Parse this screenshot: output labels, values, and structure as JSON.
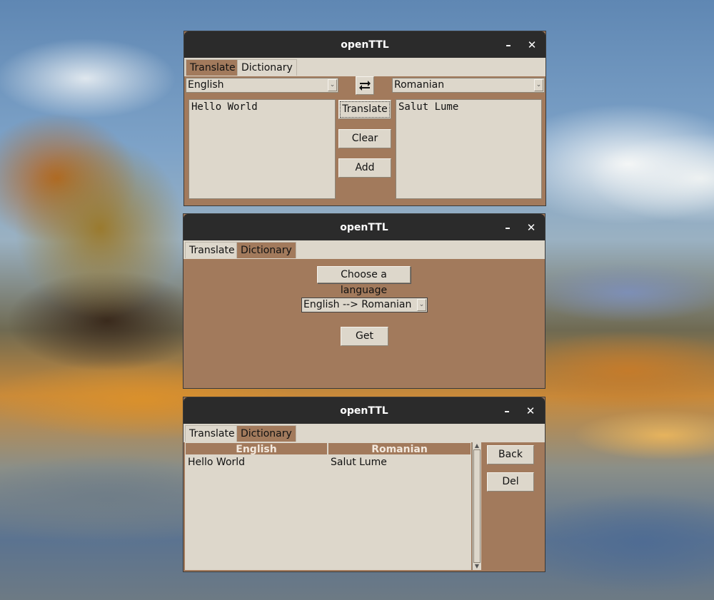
{
  "window1": {
    "title": "openTTL",
    "tabs": [
      "Translate",
      "Dictionary"
    ],
    "source_language": "English",
    "target_language": "Romanian",
    "source_text": "Hello World",
    "target_text": "Salut Lume",
    "buttons": {
      "translate": "Translate",
      "clear": "Clear",
      "add": "Add"
    }
  },
  "window2": {
    "title": "openTTL",
    "tabs": [
      "Translate",
      "Dictionary"
    ],
    "choose_button": "Choose a language",
    "language_pair": "English --> Romanian",
    "get_button": "Get"
  },
  "window3": {
    "title": "openTTL",
    "tabs": [
      "Translate",
      "Dictionary"
    ],
    "columns": [
      "English",
      "Romanian"
    ],
    "rows": [
      [
        "Hello World",
        "Salut Lume"
      ]
    ],
    "buttons": {
      "back": "Back",
      "del": "Del"
    }
  },
  "icons": {
    "minimize": "minimize-icon",
    "close": "close-icon",
    "swap": "swap-icon",
    "dropdown": "chevron-down-icon"
  },
  "colors": {
    "titlebar": "#2b2b2b",
    "window_bg": "#a27a5c",
    "widget_bg": "#ddd7cb"
  }
}
